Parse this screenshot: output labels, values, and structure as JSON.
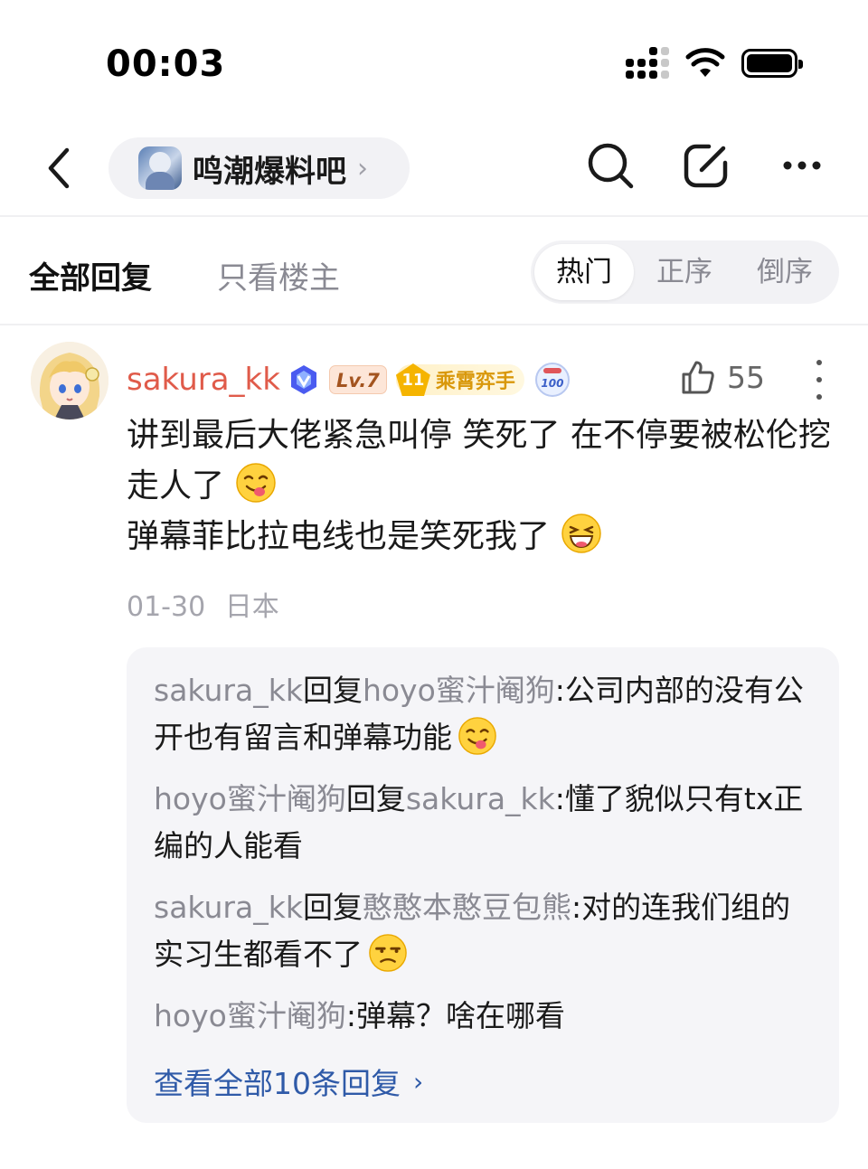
{
  "status_bar": {
    "time": "00:03"
  },
  "nav": {
    "forum_name": "鸣潮爆料吧",
    "forum_chevron": "›"
  },
  "filter": {
    "tab_all": "全部回复",
    "tab_owner_only": "只看楼主",
    "sort_options": [
      "热门",
      "正序",
      "倒序"
    ],
    "active_sort": "热门"
  },
  "comment": {
    "username": "sakura_kk",
    "level": "Lv.7",
    "medal_number": "11",
    "medal_title": "乘霄弈手",
    "badge_100": "100",
    "like_count": "55",
    "lines": [
      "讲到最后大佬紧急叫停 笑死了 在不停要被松伦挖走人了",
      "弹幕菲比拉电线也是笑死我了"
    ],
    "emojis": [
      "yum-emoji",
      "grin-emoji"
    ],
    "date": "01-30",
    "location": "日本"
  },
  "replies": {
    "items": [
      {
        "from": "sakura_kk",
        "verb": "回复",
        "to": "hoyo蜜汁阉狗",
        "text": "公司内部的没有公开也有留言和弹幕功能",
        "emoji": "yum-emoji"
      },
      {
        "from": "hoyo蜜汁阉狗",
        "verb": "回复",
        "to": "sakura_kk",
        "text": "懂了貌似只有tx正编的人能看",
        "emoji": ""
      },
      {
        "from": "sakura_kk",
        "verb": "回复",
        "to": "憨憨本憨豆包熊",
        "text": "对的连我们组的实习生都看不了",
        "emoji": "unamused-emoji"
      },
      {
        "from": "hoyo蜜汁阉狗",
        "verb": "",
        "to": "",
        "text": "弹幕？啥在哪看",
        "emoji": ""
      }
    ],
    "separator": ":",
    "view_all": "查看全部10条回复",
    "view_all_chevron": "›"
  },
  "colors": {
    "username": "#e05b4a",
    "link": "#2f5aa8",
    "muted": "#8a8a93",
    "pill_bg": "#f2f2f5"
  }
}
